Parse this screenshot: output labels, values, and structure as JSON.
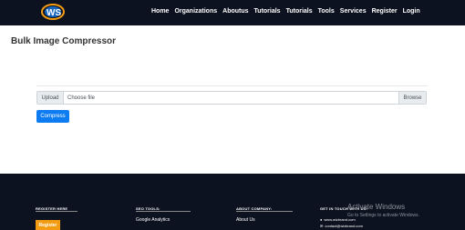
{
  "nav": {
    "items": [
      "Home",
      "Organizations",
      "Aboutus",
      "Tutorials",
      "Tutorials",
      "Tools",
      "Services",
      "Register",
      "Login"
    ]
  },
  "page": {
    "title": "Bulk Image Compressor"
  },
  "form": {
    "upload_label": "Upload",
    "file_placeholder": "Choose file",
    "browse_label": "Browse",
    "compress_label": "Compress"
  },
  "footer": {
    "register_heading": "REGISTER HERE",
    "register_button": "Register",
    "seo_heading": "SEO TOOLS:",
    "seo_link": "Google Analytics",
    "about_heading": "ABOUT COMPANY:",
    "about_link": "About Us",
    "contact_heading": "GET IN TOUCH WITH US:",
    "website": "www.wizbrand.com",
    "email": "contact@wizbrand.com"
  },
  "watermark": {
    "title": "Activate Windows",
    "subtitle": "Go to Settings to activate Windows."
  },
  "colors": {
    "nav_bg": "#0c1220",
    "accent": "#0d7cf2",
    "register": "#f39c12"
  }
}
